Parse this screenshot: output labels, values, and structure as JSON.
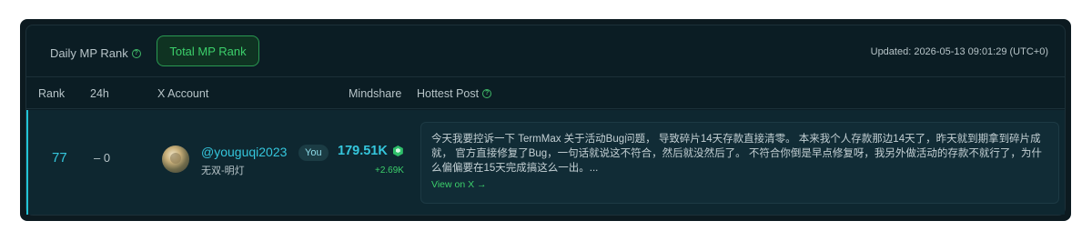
{
  "tabs": {
    "daily_label": "Daily MP Rank",
    "total_label": "Total MP Rank"
  },
  "updated": "Updated: 2026-05-13 09:01:29 (UTC+0)",
  "columns": {
    "rank": "Rank",
    "change_24h": "24h",
    "account": "X Account",
    "mindshare": "Mindshare",
    "hottest_post": "Hottest Post"
  },
  "row": {
    "rank": "77",
    "change": "– 0",
    "handle": "@youguqi2023",
    "badge": "You",
    "nickname": "无双-明灯",
    "mindshare": "179.51K",
    "mindshare_delta": "+2.69K",
    "post_text": "今天我要控诉一下 TermMax 关于活动Bug问题， 导致碎片14天存款直接清零。 本来我个人存款那边14天了，昨天就到期拿到碎片成就， 官方直接修复了Bug，一句话就说这不符合，然后就没然后了。 不符合你倒是早点修复呀，我另外做活动的存款不就行了，为什么偏偏要在15天完成搞这么一出。...",
    "post_link": "View on X →"
  },
  "colors": {
    "accent_cyan": "#35c6dc",
    "accent_green": "#3ccf6b",
    "panel_bg": "#0b1d24"
  }
}
